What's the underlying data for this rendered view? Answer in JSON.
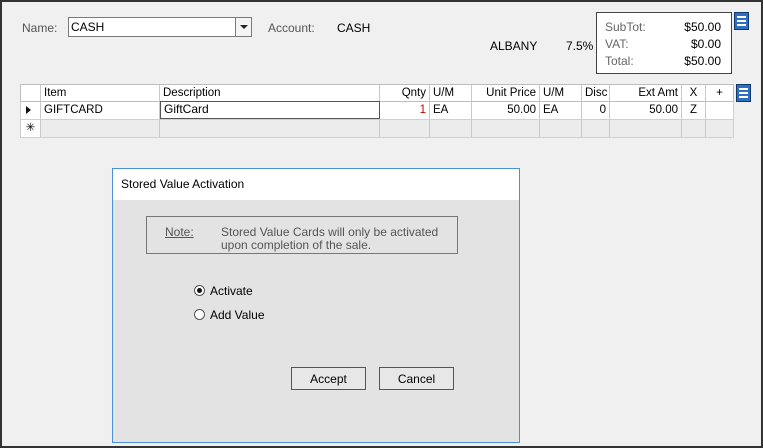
{
  "header": {
    "name_label": "Name:",
    "name_value": "CASH",
    "account_label": "Account:",
    "account_value": "CASH",
    "location": "ALBANY",
    "tax_rate": "7.5%"
  },
  "totals": {
    "subtotal_label": "SubTot:",
    "subtotal_value": "$50.00",
    "vat_label": "VAT:",
    "vat_value": "$0.00",
    "total_label": "Total:",
    "total_value": "$50.00"
  },
  "grid": {
    "columns": [
      "Item",
      "Description",
      "Qnty",
      "U/M",
      "Unit Price",
      "U/M",
      "Disc",
      "Ext Amt",
      "X",
      "+"
    ],
    "rows": [
      {
        "item": "GIFTCARD",
        "description": "GiftCard",
        "qnty": "1",
        "um": "EA",
        "unit_price": "50.00",
        "um2": "EA",
        "disc": "0",
        "ext_amt": "50.00",
        "x": "Z",
        "plus": ""
      }
    ],
    "new_row_marker": "✳"
  },
  "dialog": {
    "title": "Stored Value Activation",
    "note_label": "Note:",
    "note_line1": "Stored Value Cards will only be activated",
    "note_line2": "upon completion of the sale.",
    "options": [
      "Activate",
      "Add Value"
    ],
    "selected_option": "Activate",
    "accept_label": "Accept",
    "cancel_label": "Cancel"
  },
  "icons": {
    "menu": "menu-icon",
    "dropdown": "chevron-down-icon",
    "row_indicator": "row-pointer-icon"
  },
  "colors": {
    "accent_blue": "#2e6fc1",
    "dialog_border": "#4a90d9",
    "qty_red": "#c00000"
  }
}
